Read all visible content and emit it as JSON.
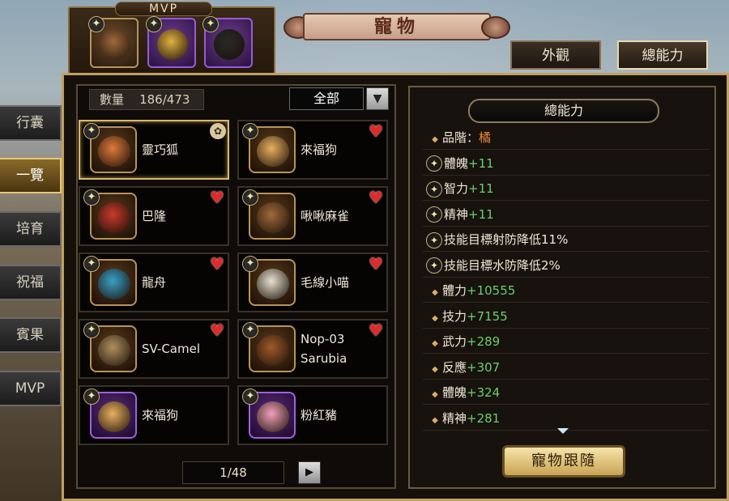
{
  "mvp": {
    "title": "MVP",
    "slots": [
      {
        "icon": "bird-pet-icon",
        "color": "#a06a3a",
        "frame": "gold"
      },
      {
        "icon": "golden-dragon-pet-icon",
        "color": "#e0b040",
        "frame": "purple"
      },
      {
        "icon": "black-beast-pet-icon",
        "color": "#2a2a2a",
        "frame": "purple"
      }
    ]
  },
  "window": {
    "title": "寵物"
  },
  "tabs": [
    {
      "label": "外觀",
      "active": false
    },
    {
      "label": "總能力",
      "active": true
    }
  ],
  "side_menu": [
    {
      "label": "行囊",
      "active": false
    },
    {
      "label": "一覽",
      "active": true
    },
    {
      "label": "培育",
      "active": false
    },
    {
      "label": "祝福",
      "active": false
    },
    {
      "label": "賓果",
      "active": false
    },
    {
      "label": "MVP",
      "active": false
    }
  ],
  "list": {
    "count_label": "數量",
    "count_value": "186/473",
    "filter": "全部",
    "pets": [
      {
        "name": "靈巧狐",
        "icon": "fox-pet-icon",
        "frame": "gold",
        "badge": "paw",
        "selected": true,
        "color": "#e07a3a"
      },
      {
        "name": "來福狗",
        "icon": "dog-pet-icon",
        "frame": "gold",
        "badge": "heart",
        "selected": false,
        "color": "#e8b060"
      },
      {
        "name": "巴隆",
        "icon": "barong-pet-icon",
        "frame": "gold",
        "badge": "heart",
        "selected": false,
        "color": "#c83a2a"
      },
      {
        "name": "啾啾麻雀",
        "icon": "sparrow-pet-icon",
        "frame": "gold",
        "badge": "heart",
        "selected": false,
        "color": "#a06a3a"
      },
      {
        "name": "龍舟",
        "icon": "dragon-boat-pet-icon",
        "frame": "gold",
        "badge": "heart",
        "selected": false,
        "color": "#3aa0c8"
      },
      {
        "name": "毛線小喵",
        "icon": "cat-pet-icon",
        "frame": "gold",
        "badge": "heart",
        "selected": false,
        "color": "#e8e0d0"
      },
      {
        "name": "SV-Camel",
        "icon": "camel-pet-icon",
        "frame": "gold",
        "badge": "heart",
        "selected": false,
        "color": "#b09060"
      },
      {
        "name": "Nop-03\nSarubia",
        "icon": "robot-pet-icon",
        "frame": "gold",
        "badge": "heart",
        "selected": false,
        "color": "#a05a2a"
      },
      {
        "name": "來福狗",
        "icon": "dog-pet-icon",
        "frame": "purple",
        "badge": "none",
        "selected": false,
        "color": "#e8b060"
      },
      {
        "name": "粉紅豬",
        "icon": "pig-pet-icon",
        "frame": "purple",
        "badge": "none",
        "selected": false,
        "color": "#f0a0b8"
      }
    ],
    "page": "1/48"
  },
  "abilities": {
    "header": "總能力",
    "rows": [
      {
        "kind": "diamond",
        "label": "品階：",
        "value": "橘",
        "value_color": "orange"
      },
      {
        "kind": "star",
        "label": "體魄",
        "value": "+11",
        "value_color": "green"
      },
      {
        "kind": "star",
        "label": "智力",
        "value": "+11",
        "value_color": "green"
      },
      {
        "kind": "star",
        "label": "精神",
        "value": "+11",
        "value_color": "green"
      },
      {
        "kind": "star",
        "label": "技能目標射防降低11%",
        "value": "",
        "value_color": "green"
      },
      {
        "kind": "star",
        "label": "技能目標水防降低2%",
        "value": "",
        "value_color": "green"
      },
      {
        "kind": "diamond",
        "label": "體力",
        "value": "+10555",
        "value_color": "green"
      },
      {
        "kind": "diamond",
        "label": "技力",
        "value": "+7155",
        "value_color": "green"
      },
      {
        "kind": "diamond",
        "label": "武力",
        "value": "+289",
        "value_color": "green"
      },
      {
        "kind": "diamond",
        "label": "反應",
        "value": "+307",
        "value_color": "green"
      },
      {
        "kind": "diamond",
        "label": "體魄",
        "value": "+324",
        "value_color": "green"
      },
      {
        "kind": "diamond",
        "label": "精神",
        "value": "+281",
        "value_color": "green"
      }
    ],
    "follow_button": "寵物跟隨"
  }
}
